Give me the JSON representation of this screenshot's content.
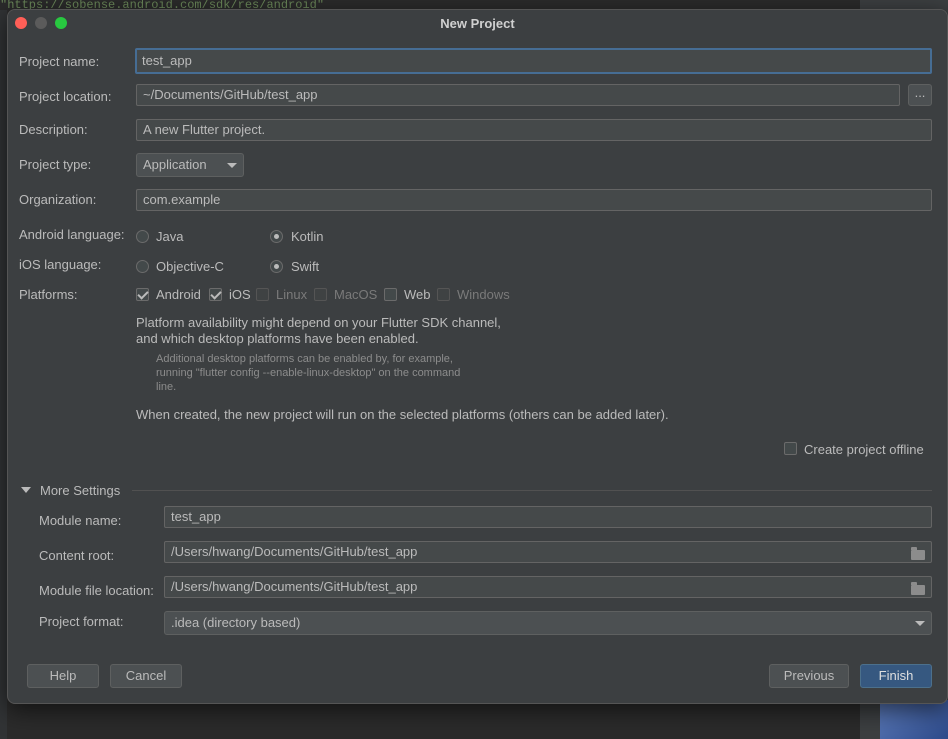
{
  "window": {
    "title": "New Project"
  },
  "background": {
    "code_snippet": "\"https://sobense.android.com/sdk/res/android\""
  },
  "form": {
    "project_name": {
      "label": "Project name:",
      "value": "test_app"
    },
    "project_location": {
      "label": "Project location:",
      "value": "~/Documents/GitHub/test_app",
      "browse_label": "..."
    },
    "description": {
      "label": "Description:",
      "value": "A new Flutter project."
    },
    "project_type": {
      "label": "Project type:",
      "value": "Application"
    },
    "organization": {
      "label": "Organization:",
      "value": "com.example"
    },
    "android_language": {
      "label": "Android language:",
      "options": [
        "Java",
        "Kotlin"
      ],
      "selected": "Kotlin"
    },
    "ios_language": {
      "label": "iOS language:",
      "options": [
        "Objective-C",
        "Swift"
      ],
      "selected": "Swift"
    },
    "platforms": {
      "label": "Platforms:",
      "items": [
        {
          "label": "Android",
          "checked": true,
          "enabled": true
        },
        {
          "label": "iOS",
          "checked": true,
          "enabled": true
        },
        {
          "label": "Linux",
          "checked": false,
          "enabled": false
        },
        {
          "label": "MacOS",
          "checked": false,
          "enabled": false
        },
        {
          "label": "Web",
          "checked": false,
          "enabled": true
        },
        {
          "label": "Windows",
          "checked": false,
          "enabled": false
        }
      ]
    },
    "platform_note_line1": "Platform availability might depend on your Flutter SDK channel,",
    "platform_note_line2": "and which desktop platforms have been enabled.",
    "platform_hint_line1": "Additional desktop platforms can be enabled by, for example,",
    "platform_hint_line2": "running \"flutter config --enable-linux-desktop\" on the command",
    "platform_hint_line3": "line.",
    "platform_created_note": "When created, the new project will run on the selected platforms (others can be added later).",
    "create_offline": {
      "label": "Create project offline",
      "checked": false
    }
  },
  "more_settings": {
    "title": "More Settings",
    "module_name": {
      "label": "Module name:",
      "value": "test_app"
    },
    "content_root": {
      "label": "Content root:",
      "value": "/Users/hwang/Documents/GitHub/test_app"
    },
    "module_file_location": {
      "label": "Module file location:",
      "value": "/Users/hwang/Documents/GitHub/test_app"
    },
    "project_format": {
      "label": "Project format:",
      "value": ".idea (directory based)"
    }
  },
  "buttons": {
    "help": "Help",
    "cancel": "Cancel",
    "previous": "Previous",
    "finish": "Finish"
  }
}
